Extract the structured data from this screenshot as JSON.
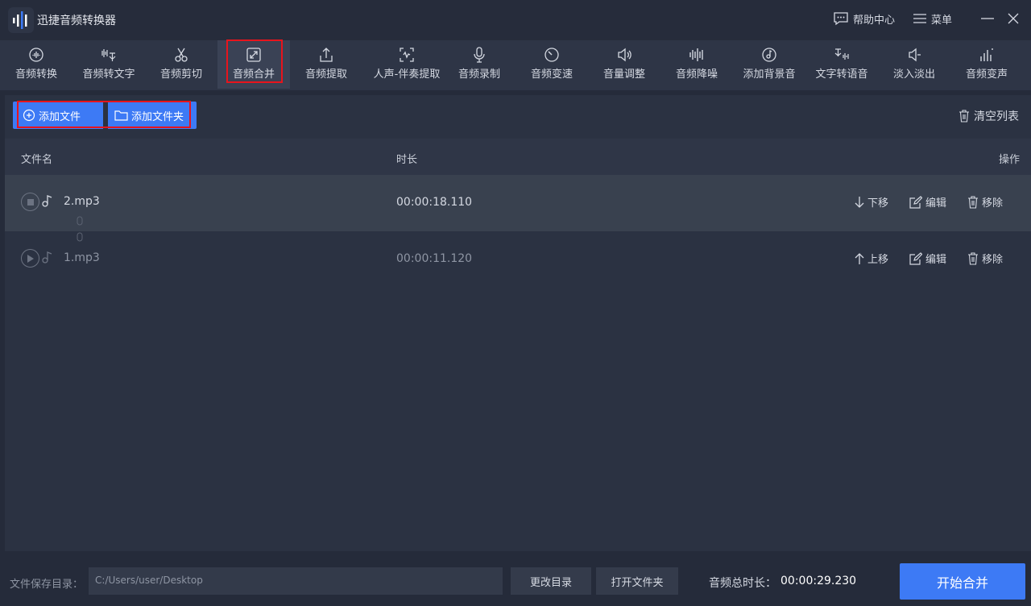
{
  "app": {
    "title": "迅捷音频转换器"
  },
  "titlebar": {
    "help_label": "帮助中心",
    "menu_label": "菜单"
  },
  "toolbar": {
    "tools": [
      {
        "label": "音频转换",
        "icon": "audio-convert-icon"
      },
      {
        "label": "音频转文字",
        "icon": "audio-to-text-icon"
      },
      {
        "label": "音频剪切",
        "icon": "scissors-icon"
      },
      {
        "label": "音频合并",
        "icon": "merge-icon",
        "active": true
      },
      {
        "label": "音频提取",
        "icon": "upload-extract-icon"
      },
      {
        "label": "人声-伴奏提取",
        "icon": "voice-extract-icon"
      },
      {
        "label": "音频录制",
        "icon": "microphone-icon"
      },
      {
        "label": "音频变速",
        "icon": "speed-icon"
      },
      {
        "label": "音量调整",
        "icon": "volume-icon"
      },
      {
        "label": "音频降噪",
        "icon": "denoise-icon"
      },
      {
        "label": "添加背景音",
        "icon": "music-disc-icon"
      },
      {
        "label": "文字转语音",
        "icon": "text-to-speech-icon"
      },
      {
        "label": "淡入淡出",
        "icon": "fade-icon"
      },
      {
        "label": "音频变声",
        "icon": "voice-change-icon"
      }
    ]
  },
  "actions": {
    "add_file": "添加文件",
    "add_folder": "添加文件夹",
    "clear_list": "清空列表"
  },
  "table": {
    "headers": {
      "name": "文件名",
      "duration": "时长",
      "ops": "操作"
    },
    "rows": [
      {
        "name": "2.mp3",
        "duration": "00:00:18.110",
        "move": "下移",
        "edit": "编辑",
        "remove": "移除"
      },
      {
        "name": "1.mp3",
        "duration": "00:00:11.120",
        "move": "上移",
        "edit": "编辑",
        "remove": "移除"
      }
    ]
  },
  "footer": {
    "save_label": "文件保存目录：",
    "save_path": "C:/Users/user/Desktop",
    "change_dir": "更改目录",
    "open_folder": "打开文件夹",
    "total_label": "音频总时长：",
    "total_value": "00:00:29.230",
    "start": "开始合并"
  },
  "colors": {
    "accent": "#3d7af5",
    "highlight_border": "#e8141c",
    "background": "#252b3a"
  }
}
